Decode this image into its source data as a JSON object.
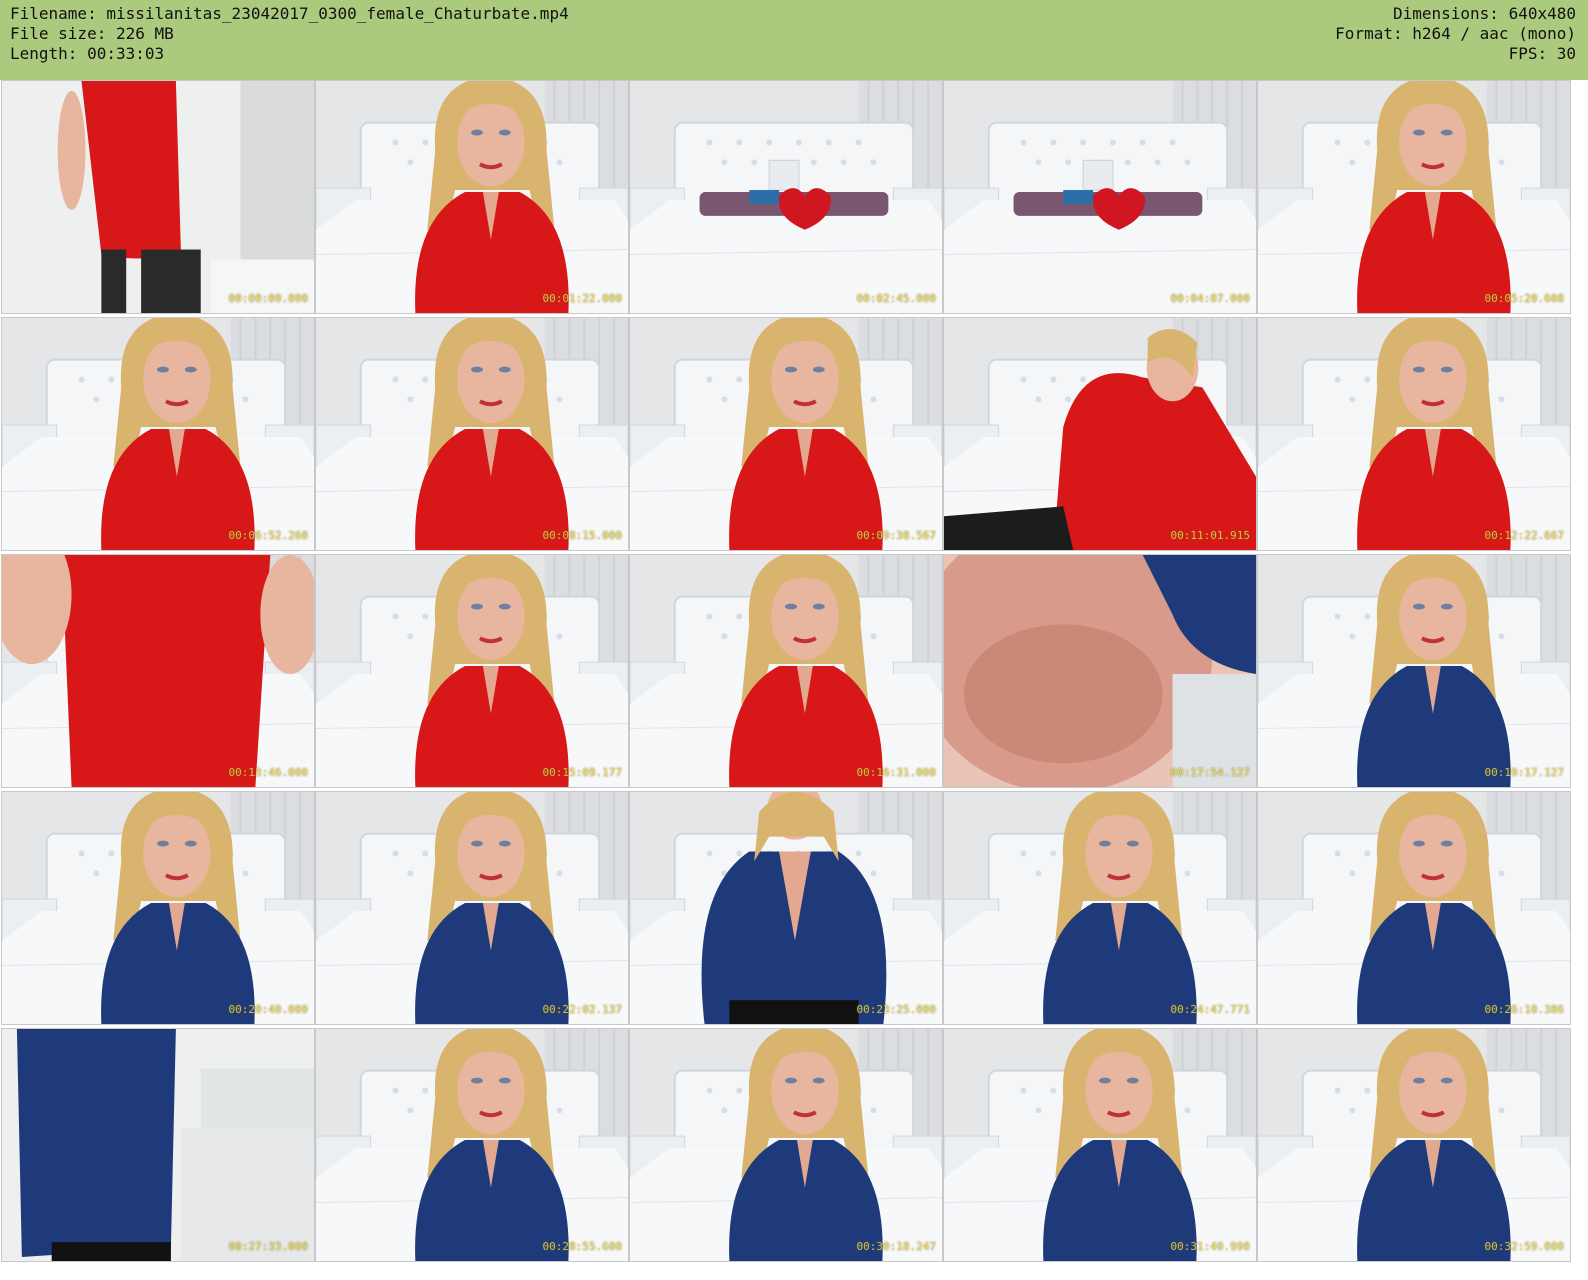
{
  "header": {
    "filename": "Filename: missilanitas_23042017_0300_female_Chaturbate.mp4",
    "filesize": "File size: 226 MB",
    "length": "Length: 00:33:03",
    "dimensions": "Dimensions: 640x480",
    "format": "Format: h264 / aac (mono)",
    "fps": "FPS: 30"
  },
  "colors": {
    "header_bg": "#acca7e",
    "red_dress": "#d81818",
    "blue_robe": "#1e3a7a",
    "wall": "#e4e6e8",
    "timestamp": "#e8d64c"
  },
  "thumbnails": [
    {
      "scene": "red-standing",
      "timestamp": "00:00:00.000"
    },
    {
      "scene": "red-face",
      "timestamp": "00:01:22.000"
    },
    {
      "scene": "empty-bed",
      "timestamp": "00:02:45.000"
    },
    {
      "scene": "empty-bed",
      "timestamp": "00:04:07.000"
    },
    {
      "scene": "red-face",
      "timestamp": "00:05:20.608"
    },
    {
      "scene": "red-face",
      "timestamp": "00:06:52.260"
    },
    {
      "scene": "red-face",
      "timestamp": "00:08:15.000"
    },
    {
      "scene": "red-face",
      "timestamp": "00:09:38.567"
    },
    {
      "scene": "red-reclined",
      "timestamp": "00:11:01.915"
    },
    {
      "scene": "red-face",
      "timestamp": "00:12:22.667"
    },
    {
      "scene": "red-torso",
      "timestamp": "00:13:46.000"
    },
    {
      "scene": "red-face",
      "timestamp": "00:15:09.177"
    },
    {
      "scene": "red-face",
      "timestamp": "00:16:31.000"
    },
    {
      "scene": "closeup",
      "timestamp": "00:17:54.127"
    },
    {
      "scene": "blue-face",
      "timestamp": "00:19:17.127"
    },
    {
      "scene": "blue-face",
      "timestamp": "00:20:40.000"
    },
    {
      "scene": "blue-face",
      "timestamp": "00:22:02.137"
    },
    {
      "scene": "blue-seated",
      "timestamp": "00:23:25.000"
    },
    {
      "scene": "blue-face",
      "timestamp": "00:24:47.771"
    },
    {
      "scene": "blue-face",
      "timestamp": "00:26:10.386"
    },
    {
      "scene": "blue-standing",
      "timestamp": "00:27:33.000"
    },
    {
      "scene": "blue-face",
      "timestamp": "00:28:55.600"
    },
    {
      "scene": "blue-face",
      "timestamp": "00:30:18.247"
    },
    {
      "scene": "blue-face",
      "timestamp": "00:31:40.990"
    },
    {
      "scene": "blue-face",
      "timestamp": "00:32:59.000"
    }
  ]
}
